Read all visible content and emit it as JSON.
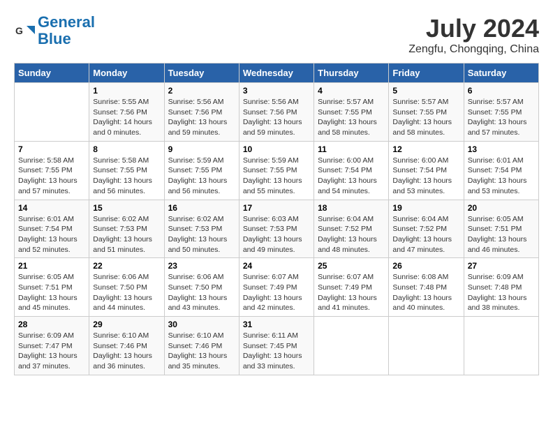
{
  "header": {
    "logo_line1": "General",
    "logo_line2": "Blue",
    "month": "July 2024",
    "location": "Zengfu, Chongqing, China"
  },
  "days_of_week": [
    "Sunday",
    "Monday",
    "Tuesday",
    "Wednesday",
    "Thursday",
    "Friday",
    "Saturday"
  ],
  "weeks": [
    [
      {
        "day": "",
        "info": ""
      },
      {
        "day": "1",
        "info": "Sunrise: 5:55 AM\nSunset: 7:56 PM\nDaylight: 14 hours\nand 0 minutes."
      },
      {
        "day": "2",
        "info": "Sunrise: 5:56 AM\nSunset: 7:56 PM\nDaylight: 13 hours\nand 59 minutes."
      },
      {
        "day": "3",
        "info": "Sunrise: 5:56 AM\nSunset: 7:56 PM\nDaylight: 13 hours\nand 59 minutes."
      },
      {
        "day": "4",
        "info": "Sunrise: 5:57 AM\nSunset: 7:55 PM\nDaylight: 13 hours\nand 58 minutes."
      },
      {
        "day": "5",
        "info": "Sunrise: 5:57 AM\nSunset: 7:55 PM\nDaylight: 13 hours\nand 58 minutes."
      },
      {
        "day": "6",
        "info": "Sunrise: 5:57 AM\nSunset: 7:55 PM\nDaylight: 13 hours\nand 57 minutes."
      }
    ],
    [
      {
        "day": "7",
        "info": "Sunrise: 5:58 AM\nSunset: 7:55 PM\nDaylight: 13 hours\nand 57 minutes."
      },
      {
        "day": "8",
        "info": "Sunrise: 5:58 AM\nSunset: 7:55 PM\nDaylight: 13 hours\nand 56 minutes."
      },
      {
        "day": "9",
        "info": "Sunrise: 5:59 AM\nSunset: 7:55 PM\nDaylight: 13 hours\nand 56 minutes."
      },
      {
        "day": "10",
        "info": "Sunrise: 5:59 AM\nSunset: 7:55 PM\nDaylight: 13 hours\nand 55 minutes."
      },
      {
        "day": "11",
        "info": "Sunrise: 6:00 AM\nSunset: 7:54 PM\nDaylight: 13 hours\nand 54 minutes."
      },
      {
        "day": "12",
        "info": "Sunrise: 6:00 AM\nSunset: 7:54 PM\nDaylight: 13 hours\nand 53 minutes."
      },
      {
        "day": "13",
        "info": "Sunrise: 6:01 AM\nSunset: 7:54 PM\nDaylight: 13 hours\nand 53 minutes."
      }
    ],
    [
      {
        "day": "14",
        "info": "Sunrise: 6:01 AM\nSunset: 7:54 PM\nDaylight: 13 hours\nand 52 minutes."
      },
      {
        "day": "15",
        "info": "Sunrise: 6:02 AM\nSunset: 7:53 PM\nDaylight: 13 hours\nand 51 minutes."
      },
      {
        "day": "16",
        "info": "Sunrise: 6:02 AM\nSunset: 7:53 PM\nDaylight: 13 hours\nand 50 minutes."
      },
      {
        "day": "17",
        "info": "Sunrise: 6:03 AM\nSunset: 7:53 PM\nDaylight: 13 hours\nand 49 minutes."
      },
      {
        "day": "18",
        "info": "Sunrise: 6:04 AM\nSunset: 7:52 PM\nDaylight: 13 hours\nand 48 minutes."
      },
      {
        "day": "19",
        "info": "Sunrise: 6:04 AM\nSunset: 7:52 PM\nDaylight: 13 hours\nand 47 minutes."
      },
      {
        "day": "20",
        "info": "Sunrise: 6:05 AM\nSunset: 7:51 PM\nDaylight: 13 hours\nand 46 minutes."
      }
    ],
    [
      {
        "day": "21",
        "info": "Sunrise: 6:05 AM\nSunset: 7:51 PM\nDaylight: 13 hours\nand 45 minutes."
      },
      {
        "day": "22",
        "info": "Sunrise: 6:06 AM\nSunset: 7:50 PM\nDaylight: 13 hours\nand 44 minutes."
      },
      {
        "day": "23",
        "info": "Sunrise: 6:06 AM\nSunset: 7:50 PM\nDaylight: 13 hours\nand 43 minutes."
      },
      {
        "day": "24",
        "info": "Sunrise: 6:07 AM\nSunset: 7:49 PM\nDaylight: 13 hours\nand 42 minutes."
      },
      {
        "day": "25",
        "info": "Sunrise: 6:07 AM\nSunset: 7:49 PM\nDaylight: 13 hours\nand 41 minutes."
      },
      {
        "day": "26",
        "info": "Sunrise: 6:08 AM\nSunset: 7:48 PM\nDaylight: 13 hours\nand 40 minutes."
      },
      {
        "day": "27",
        "info": "Sunrise: 6:09 AM\nSunset: 7:48 PM\nDaylight: 13 hours\nand 38 minutes."
      }
    ],
    [
      {
        "day": "28",
        "info": "Sunrise: 6:09 AM\nSunset: 7:47 PM\nDaylight: 13 hours\nand 37 minutes."
      },
      {
        "day": "29",
        "info": "Sunrise: 6:10 AM\nSunset: 7:46 PM\nDaylight: 13 hours\nand 36 minutes."
      },
      {
        "day": "30",
        "info": "Sunrise: 6:10 AM\nSunset: 7:46 PM\nDaylight: 13 hours\nand 35 minutes."
      },
      {
        "day": "31",
        "info": "Sunrise: 6:11 AM\nSunset: 7:45 PM\nDaylight: 13 hours\nand 33 minutes."
      },
      {
        "day": "",
        "info": ""
      },
      {
        "day": "",
        "info": ""
      },
      {
        "day": "",
        "info": ""
      }
    ]
  ]
}
